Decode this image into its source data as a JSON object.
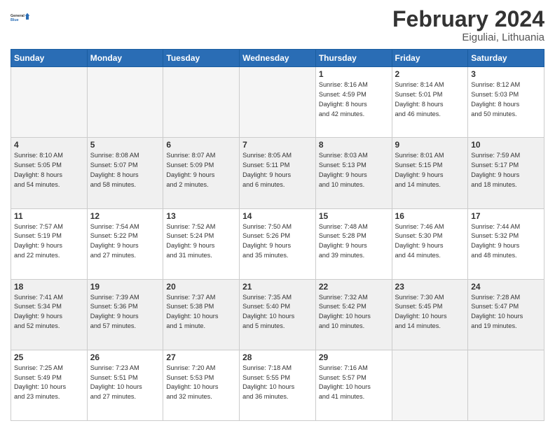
{
  "header": {
    "logo_line1": "General",
    "logo_line2": "Blue",
    "title": "February 2024",
    "subtitle": "Eiguliai, Lithuania"
  },
  "weekdays": [
    "Sunday",
    "Monday",
    "Tuesday",
    "Wednesday",
    "Thursday",
    "Friday",
    "Saturday"
  ],
  "weeks": [
    [
      {
        "day": "",
        "info": ""
      },
      {
        "day": "",
        "info": ""
      },
      {
        "day": "",
        "info": ""
      },
      {
        "day": "",
        "info": ""
      },
      {
        "day": "1",
        "info": "Sunrise: 8:16 AM\nSunset: 4:59 PM\nDaylight: 8 hours\nand 42 minutes."
      },
      {
        "day": "2",
        "info": "Sunrise: 8:14 AM\nSunset: 5:01 PM\nDaylight: 8 hours\nand 46 minutes."
      },
      {
        "day": "3",
        "info": "Sunrise: 8:12 AM\nSunset: 5:03 PM\nDaylight: 8 hours\nand 50 minutes."
      }
    ],
    [
      {
        "day": "4",
        "info": "Sunrise: 8:10 AM\nSunset: 5:05 PM\nDaylight: 8 hours\nand 54 minutes."
      },
      {
        "day": "5",
        "info": "Sunrise: 8:08 AM\nSunset: 5:07 PM\nDaylight: 8 hours\nand 58 minutes."
      },
      {
        "day": "6",
        "info": "Sunrise: 8:07 AM\nSunset: 5:09 PM\nDaylight: 9 hours\nand 2 minutes."
      },
      {
        "day": "7",
        "info": "Sunrise: 8:05 AM\nSunset: 5:11 PM\nDaylight: 9 hours\nand 6 minutes."
      },
      {
        "day": "8",
        "info": "Sunrise: 8:03 AM\nSunset: 5:13 PM\nDaylight: 9 hours\nand 10 minutes."
      },
      {
        "day": "9",
        "info": "Sunrise: 8:01 AM\nSunset: 5:15 PM\nDaylight: 9 hours\nand 14 minutes."
      },
      {
        "day": "10",
        "info": "Sunrise: 7:59 AM\nSunset: 5:17 PM\nDaylight: 9 hours\nand 18 minutes."
      }
    ],
    [
      {
        "day": "11",
        "info": "Sunrise: 7:57 AM\nSunset: 5:19 PM\nDaylight: 9 hours\nand 22 minutes."
      },
      {
        "day": "12",
        "info": "Sunrise: 7:54 AM\nSunset: 5:22 PM\nDaylight: 9 hours\nand 27 minutes."
      },
      {
        "day": "13",
        "info": "Sunrise: 7:52 AM\nSunset: 5:24 PM\nDaylight: 9 hours\nand 31 minutes."
      },
      {
        "day": "14",
        "info": "Sunrise: 7:50 AM\nSunset: 5:26 PM\nDaylight: 9 hours\nand 35 minutes."
      },
      {
        "day": "15",
        "info": "Sunrise: 7:48 AM\nSunset: 5:28 PM\nDaylight: 9 hours\nand 39 minutes."
      },
      {
        "day": "16",
        "info": "Sunrise: 7:46 AM\nSunset: 5:30 PM\nDaylight: 9 hours\nand 44 minutes."
      },
      {
        "day": "17",
        "info": "Sunrise: 7:44 AM\nSunset: 5:32 PM\nDaylight: 9 hours\nand 48 minutes."
      }
    ],
    [
      {
        "day": "18",
        "info": "Sunrise: 7:41 AM\nSunset: 5:34 PM\nDaylight: 9 hours\nand 52 minutes."
      },
      {
        "day": "19",
        "info": "Sunrise: 7:39 AM\nSunset: 5:36 PM\nDaylight: 9 hours\nand 57 minutes."
      },
      {
        "day": "20",
        "info": "Sunrise: 7:37 AM\nSunset: 5:38 PM\nDaylight: 10 hours\nand 1 minute."
      },
      {
        "day": "21",
        "info": "Sunrise: 7:35 AM\nSunset: 5:40 PM\nDaylight: 10 hours\nand 5 minutes."
      },
      {
        "day": "22",
        "info": "Sunrise: 7:32 AM\nSunset: 5:42 PM\nDaylight: 10 hours\nand 10 minutes."
      },
      {
        "day": "23",
        "info": "Sunrise: 7:30 AM\nSunset: 5:45 PM\nDaylight: 10 hours\nand 14 minutes."
      },
      {
        "day": "24",
        "info": "Sunrise: 7:28 AM\nSunset: 5:47 PM\nDaylight: 10 hours\nand 19 minutes."
      }
    ],
    [
      {
        "day": "25",
        "info": "Sunrise: 7:25 AM\nSunset: 5:49 PM\nDaylight: 10 hours\nand 23 minutes."
      },
      {
        "day": "26",
        "info": "Sunrise: 7:23 AM\nSunset: 5:51 PM\nDaylight: 10 hours\nand 27 minutes."
      },
      {
        "day": "27",
        "info": "Sunrise: 7:20 AM\nSunset: 5:53 PM\nDaylight: 10 hours\nand 32 minutes."
      },
      {
        "day": "28",
        "info": "Sunrise: 7:18 AM\nSunset: 5:55 PM\nDaylight: 10 hours\nand 36 minutes."
      },
      {
        "day": "29",
        "info": "Sunrise: 7:16 AM\nSunset: 5:57 PM\nDaylight: 10 hours\nand 41 minutes."
      },
      {
        "day": "",
        "info": ""
      },
      {
        "day": "",
        "info": ""
      }
    ]
  ]
}
